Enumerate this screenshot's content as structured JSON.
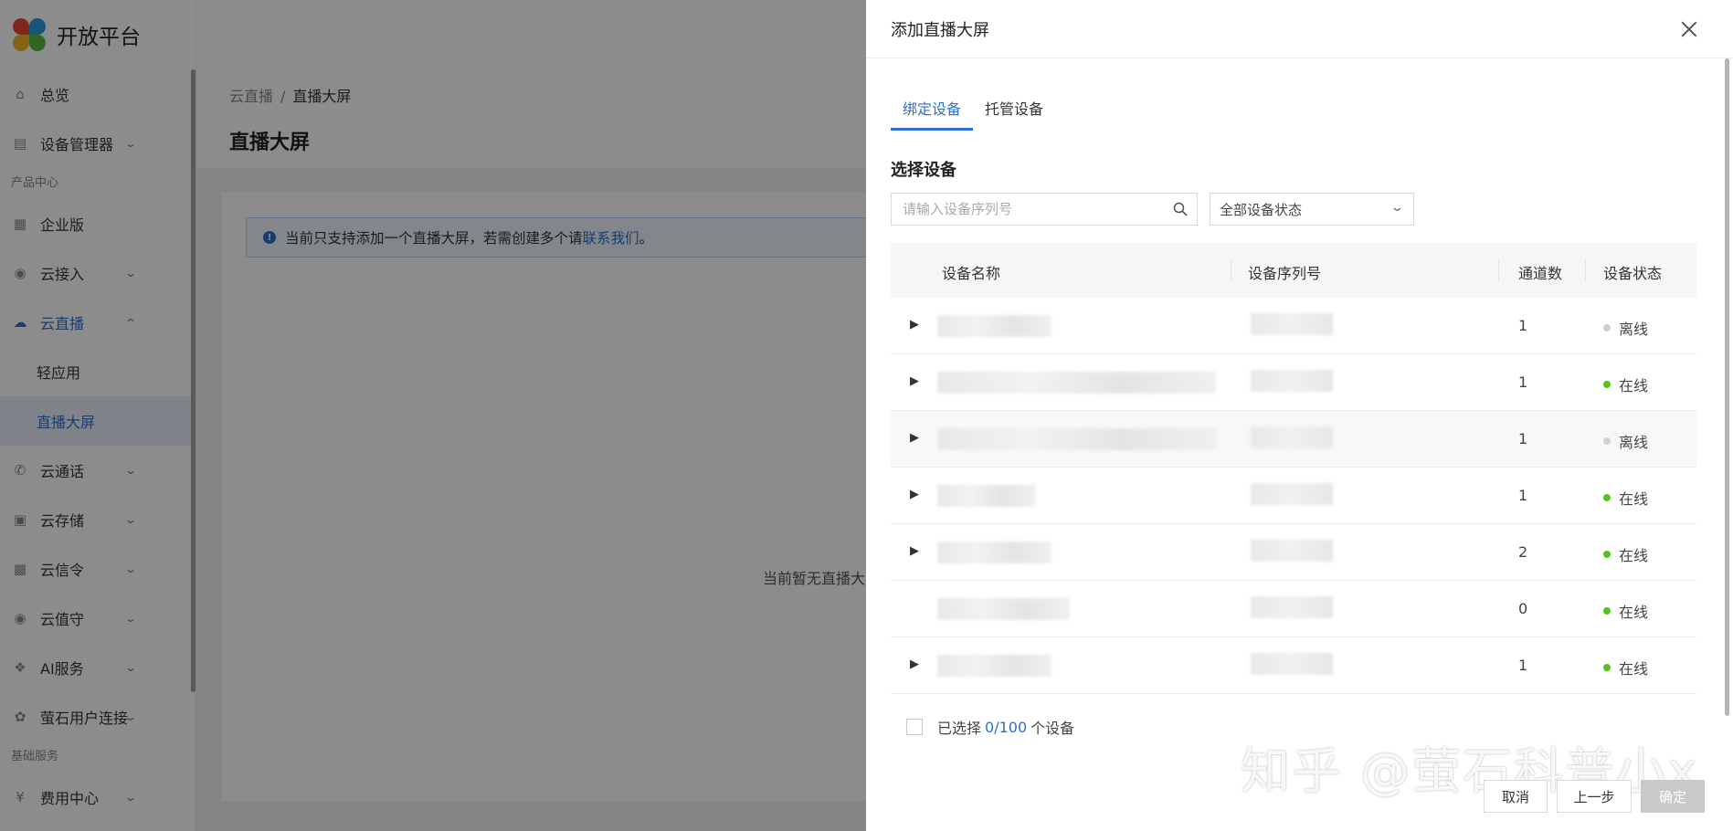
{
  "app": {
    "title": "开放平台"
  },
  "sidebar": {
    "items": [
      {
        "label": "总览",
        "icon": "home-icon"
      },
      {
        "label": "设备管理器",
        "icon": "server-icon",
        "expandable": true
      },
      {
        "section": "产品中心"
      },
      {
        "label": "企业版",
        "icon": "building-icon"
      },
      {
        "label": "云接入",
        "icon": "shield-icon",
        "expandable": true
      },
      {
        "label": "云直播",
        "icon": "cloud-icon",
        "expandable": true,
        "open": true
      },
      {
        "sub": "轻应用"
      },
      {
        "sub": "直播大屏",
        "active": true
      },
      {
        "label": "云通话",
        "icon": "phone-icon",
        "expandable": true
      },
      {
        "label": "云存储",
        "icon": "save-icon",
        "expandable": true
      },
      {
        "label": "云信令",
        "icon": "message-icon",
        "expandable": true
      },
      {
        "label": "云值守",
        "icon": "camera-icon",
        "expandable": true
      },
      {
        "label": "AI服务",
        "icon": "ai-icon",
        "expandable": true
      },
      {
        "label": "萤石用户连接",
        "icon": "connect-icon",
        "expandable": true
      },
      {
        "section": "基础服务"
      },
      {
        "label": "费用中心",
        "icon": "yen-icon",
        "expandable": true
      }
    ]
  },
  "breadcrumb": {
    "parent": "云直播",
    "separator": "/",
    "current": "直播大屏"
  },
  "page": {
    "title": "直播大屏",
    "alert_text": "当前只支持添加一个直播大屏，若需创建多个请",
    "alert_link": "联系我们",
    "alert_suffix": "。",
    "empty_text": "当前暂无直播大"
  },
  "drawer": {
    "title": "添加直播大屏",
    "tabs": [
      {
        "label": "绑定设备",
        "active": true
      },
      {
        "label": "托管设备"
      }
    ],
    "section_title": "选择设备",
    "search_placeholder": "请输入设备序列号",
    "status_filter": "全部设备状态",
    "table": {
      "headers": {
        "name": "设备名称",
        "serial": "设备序列号",
        "channels": "通道数",
        "status": "设备状态"
      },
      "rows": [
        {
          "channels": "1",
          "status": "离线",
          "online": false,
          "expandable": true
        },
        {
          "channels": "1",
          "status": "在线",
          "online": true,
          "expandable": true
        },
        {
          "channels": "1",
          "status": "离线",
          "online": false,
          "expandable": true
        },
        {
          "channels": "1",
          "status": "在线",
          "online": true,
          "expandable": true
        },
        {
          "channels": "2",
          "status": "在线",
          "online": true,
          "expandable": true
        },
        {
          "channels": "0",
          "status": "在线",
          "online": true,
          "expandable": false
        },
        {
          "channels": "1",
          "status": "在线",
          "online": true,
          "expandable": true
        }
      ]
    },
    "selection": {
      "prefix": "已选择",
      "count": "0/100",
      "suffix": "个设备"
    },
    "buttons": {
      "cancel": "取消",
      "prev": "上一步",
      "confirm": "确定"
    },
    "watermark": "知乎 @萤石科普小x"
  },
  "colors": {
    "accent": "#2b6fd6",
    "online": "#52c41a",
    "offline": "#d0d0d0"
  }
}
